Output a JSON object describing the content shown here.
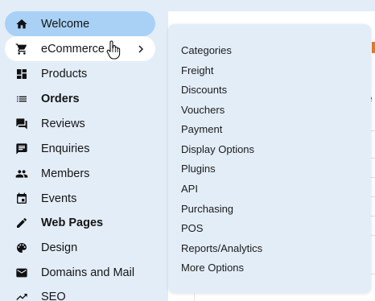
{
  "sidebar": {
    "items": [
      {
        "label": "Welcome",
        "icon": "home-icon"
      },
      {
        "label": "eCommerce",
        "icon": "cart-icon"
      },
      {
        "label": "Products",
        "icon": "dashboard-icon"
      },
      {
        "label": "Orders",
        "icon": "list-icon"
      },
      {
        "label": "Reviews",
        "icon": "forum-icon"
      },
      {
        "label": "Enquiries",
        "icon": "message-icon"
      },
      {
        "label": "Members",
        "icon": "people-icon"
      },
      {
        "label": "Events",
        "icon": "calendar-icon"
      },
      {
        "label": "Web Pages",
        "icon": "pencil-icon"
      },
      {
        "label": "Design",
        "icon": "palette-icon"
      },
      {
        "label": "Domains and Mail",
        "icon": "mail-icon"
      },
      {
        "label": "SEO",
        "icon": "trending-icon"
      }
    ]
  },
  "submenu": {
    "items": [
      "Categories",
      "Freight",
      "Discounts",
      "Vouchers",
      "Payment",
      "Display Options",
      "Plugins",
      "API",
      "Purchasing",
      "POS",
      "Reports/Analytics",
      "More Options"
    ]
  },
  "background": {
    "partial_char": "e"
  },
  "colors": {
    "active_item": "#a8d1f5",
    "hover_item": "#ffffff",
    "page_bg": "#e3edf8",
    "accent": "#e07c2a"
  }
}
